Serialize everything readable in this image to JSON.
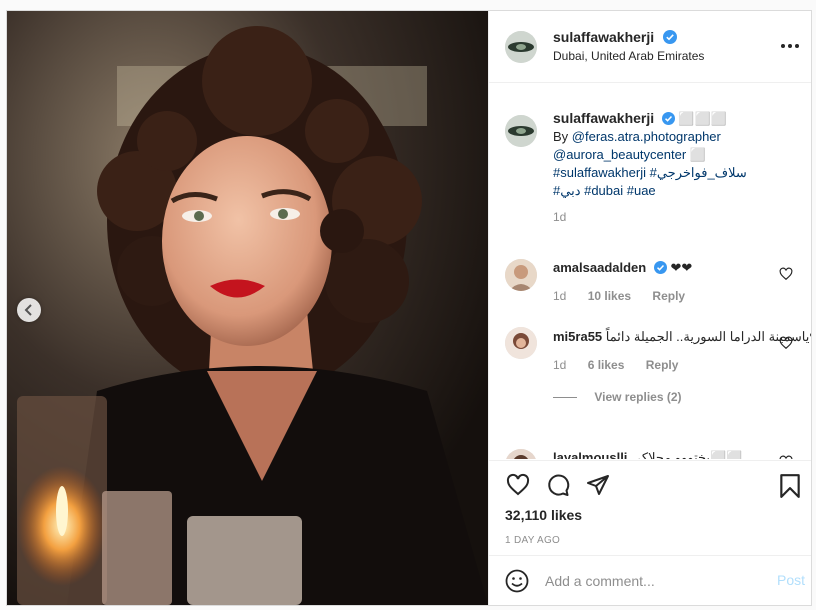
{
  "post": {
    "author": "sulaffawakherji",
    "location": "Dubai, United Arab Emirates",
    "caption": {
      "emoji": "⬜⬜⬜",
      "by_text": "By",
      "mention1": "@feras.atra.photographer",
      "mention2": "@aurora_beautycenter",
      "trail_emoji": "⬜",
      "hashtag_line1": "#sulaffawakherji #سلاف_فواخرجي",
      "hashtag_line2": "#دبي #dubai #uae",
      "time": "1d"
    },
    "comments": [
      {
        "user": "amalsaadalden",
        "text": "❤❤",
        "time": "1d",
        "likes": "10 likes",
        "reply": "Reply"
      },
      {
        "user": "mi5ra55",
        "text": "ياسمينة الدراما السورية.. الجميلة دائماً❤",
        "time": "1d",
        "likes": "6 likes",
        "reply": "Reply",
        "view_replies": "View replies (2)"
      },
      {
        "user": "layalmouslli",
        "text": "يختووو محلاكي⬜⬜"
      }
    ],
    "likes_count": "32,110 likes",
    "time_ago": "1 DAY AGO",
    "comment_placeholder": "Add a comment...",
    "post_label": "Post"
  },
  "colors": {
    "verified": "#3897f0",
    "link": "#00376b",
    "muted": "#8e8e8e",
    "post_disabled": "#b2dffc"
  },
  "icons": [
    "chevron-left-icon",
    "more-icon",
    "verified-icon",
    "heart-icon",
    "comment-icon",
    "share-icon",
    "bookmark-icon",
    "smile-icon"
  ]
}
